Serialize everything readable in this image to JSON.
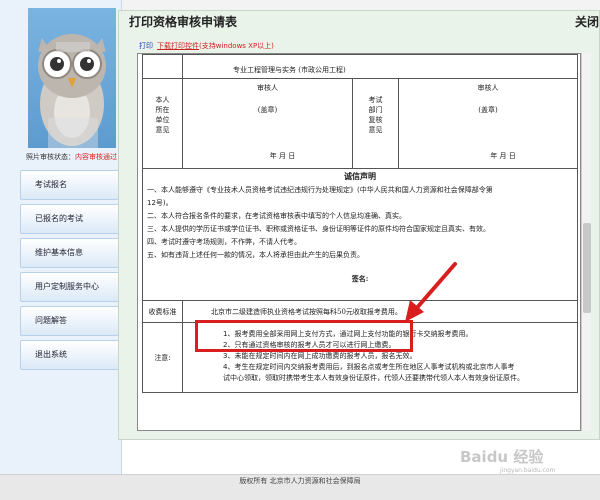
{
  "dialog": {
    "title": "打印资格审核申请表",
    "close_label": "关闭"
  },
  "toolbar": {
    "print_label": "打印",
    "control_link": "下载打印控件",
    "control_note": "(支持windows XP以上)"
  },
  "sidebar": {
    "status_prefix": "照片审核状态：",
    "status_value": "内容审核通过",
    "items": [
      {
        "label": "考试报名"
      },
      {
        "label": "已报名的考试"
      },
      {
        "label": "维护基本信息"
      },
      {
        "label": "用户定制服务中心"
      },
      {
        "label": "问题解答"
      },
      {
        "label": "退出系统"
      }
    ]
  },
  "form": {
    "specialty_value": "专业工程管理与实务 (市政公用工程)",
    "unit_label": [
      "本人",
      "所在",
      "单位",
      "意见"
    ],
    "dept_label": [
      "考试",
      "部门",
      "复核",
      "意见"
    ],
    "reviewer": "审核人",
    "seal": "(盖章)",
    "date": "年  月  日",
    "integrity_title": "诚信声明",
    "integrity_lines": [
      "一、本人能够遵守《专业技术人员资格考试违纪违规行为处理规定》(中华人民共和国人力资源和社会保障部令第",
      "12号)。",
      "二、本人符合报名条件的要求，在考试资格审核表中填写的个人信息均准确、真实。",
      "三、本人提供的学历证书或学位证书、职称或资格证书、身份证明等证件的原件均符合国家规定且真实、有效。",
      "四、考试时遵守考场规则，不作弊，不请人代考。",
      "五、如有违背上述任何一款的情况，本人将承担由此产生的后果负责。"
    ],
    "signature_label": "签名:",
    "fee_label": "收费标准",
    "fee_value": "北京市二级建造师执业资格考试按照每科50元收取报考费用。",
    "notes_label": "注意:",
    "notes": [
      "1、报考费用全部采用网上支付方式，通过网上支付功能的银行卡交纳报考费用。",
      "2、只有通过资格审核的报考人员才可以进行网上缴费。",
      "3、未能在规定时间内在网上成功缴费的报考人员，报名无效。",
      "4、考生在规定时间内交纳报考费用后，到报名点或考生所在地区人事考试机构或北京市人事考",
      "试中心领取，领取时携带考生本人有效身份证原件，代领人还要携带代领人本人有效身份证原件。"
    ]
  },
  "footer": {
    "copyright": "版权所有 北京市人力资源和社会保障局"
  },
  "watermark": {
    "text": "Baidu 经验",
    "sub": "jingyan.baidu.com"
  },
  "colors": {
    "highlight": "#d81e1e",
    "dialog_bg": "#eaf3ea",
    "sidebar_bg": "#e9f2fb"
  }
}
